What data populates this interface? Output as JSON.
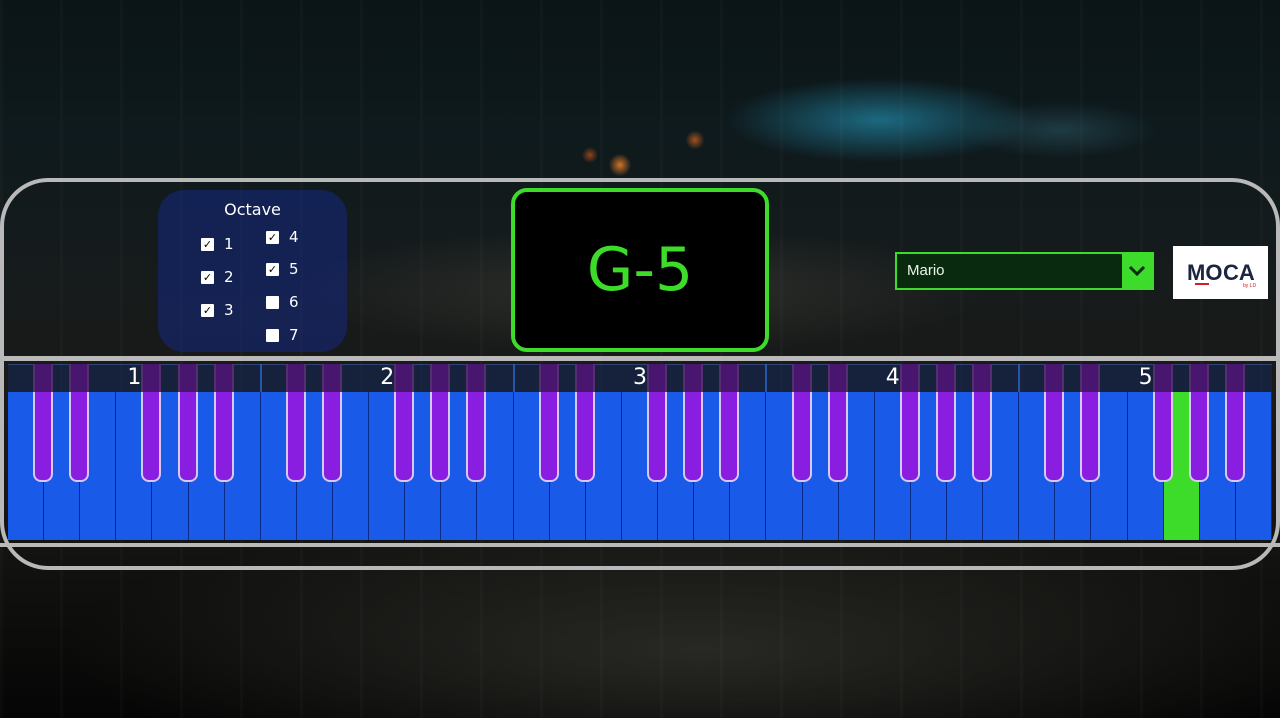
{
  "octave_panel": {
    "title": "Octave",
    "options": [
      {
        "label": "1",
        "checked": true
      },
      {
        "label": "2",
        "checked": true
      },
      {
        "label": "3",
        "checked": true
      },
      {
        "label": "4",
        "checked": true
      },
      {
        "label": "5",
        "checked": true
      },
      {
        "label": "6",
        "checked": false
      },
      {
        "label": "7",
        "checked": false
      }
    ]
  },
  "note_display": {
    "value": "G-5"
  },
  "song_select": {
    "value": "Mario"
  },
  "logo": {
    "text": "MOCA",
    "sub": "by LD"
  },
  "keyboard": {
    "octave_labels": [
      "1",
      "2",
      "3",
      "4",
      "5"
    ],
    "active_note": "G-5"
  },
  "colors": {
    "accent_green": "#3ddc2a",
    "white_key": "#1a5ae8",
    "black_key": "#8a1ee0",
    "panel_blue": "#14288a",
    "frame": "#b9b9b9"
  }
}
